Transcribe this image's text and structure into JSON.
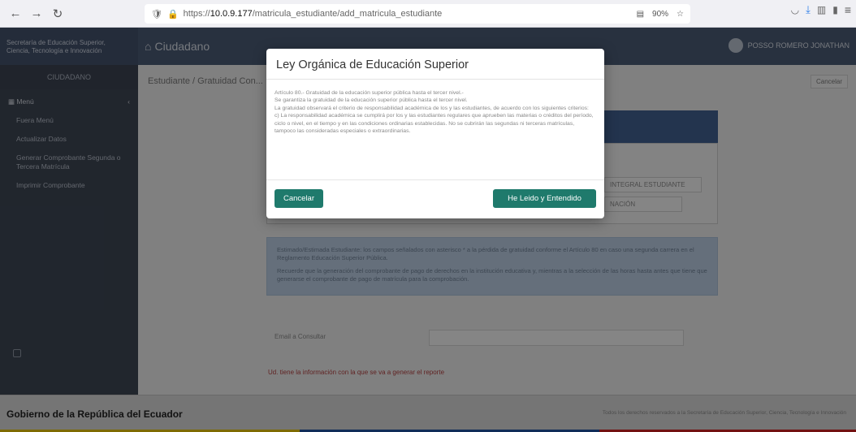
{
  "browser": {
    "url_prefix": "https://",
    "url_host": "10.0.9.177",
    "url_path": "/matricula_estudiante/add_matricula_estudiante",
    "zoom": "90%"
  },
  "header": {
    "brand_line1": "Secretaría de Educación Superior,",
    "brand_line2": "Ciencia, Tecnología e Innovación",
    "app_title": "Ciudadano",
    "user_name": "POSSO ROMERO JONATHAN"
  },
  "sidebar": {
    "top_label": "CIUDADANO",
    "menu_label": "Menú",
    "items": [
      "Fuera Menú",
      "Actualizar Datos",
      "Generar Comprobante Segunda o Tercera Matrícula",
      "Imprimir Comprobante"
    ]
  },
  "main": {
    "breadcrumb": "Estudiante / Gratuidad Con...",
    "cancel_label": "Cancelar",
    "select1": "INTEGRAL ESTUDIANTE",
    "select2": "NACIÓN",
    "info_p1": "Estimado/Estimada Estudiante: los campos señalados con asterisco * a la pérdida de gratuidad conforme el Artículo 80 en caso una segunda carrera en el Reglamento Educación Superior Pública.",
    "info_p2": "Recuerde que la generación del comprobante de pago de derechos en la institución educativa y, mientras a la selección de las horas hasta antes que tiene que generarse el comprobante de pago de matrícula para la comprobación.",
    "email_label": "Email a Consultar",
    "red_link": "Ud. tiene la información con la que se va a generar el reporte"
  },
  "footer": {
    "title": "Gobierno de la República del Ecuador",
    "right_text": "Todos los derechos reservados a la Secretaría de Educación Superior, Ciencia, Tecnología e Innovación"
  },
  "modal": {
    "title": "Ley Orgánica de Educación Superior",
    "body_lines": [
      "Artículo 80.- Gratuidad de la educación superior pública hasta el tercer nivel.-",
      "Se garantiza la gratuidad de la educación superior pública hasta el tercer nivel.",
      "La gratuidad observará el criterio de responsabilidad académica de los y las estudiantes, de acuerdo con los siguientes criterios:",
      "c) La responsabilidad académica se cumplirá por los y las estudiantes regulares que aprueben las materias o créditos del período, ciclo o nivel, en el tiempo y en las condiciones ordinarias establecidas. No se cubrirán las segundas ni terceras matrículas, tampoco las consideradas especiales o extraordinarias."
    ],
    "cancel_label": "Cancelar",
    "accept_label": "He Leido y Entendido"
  }
}
